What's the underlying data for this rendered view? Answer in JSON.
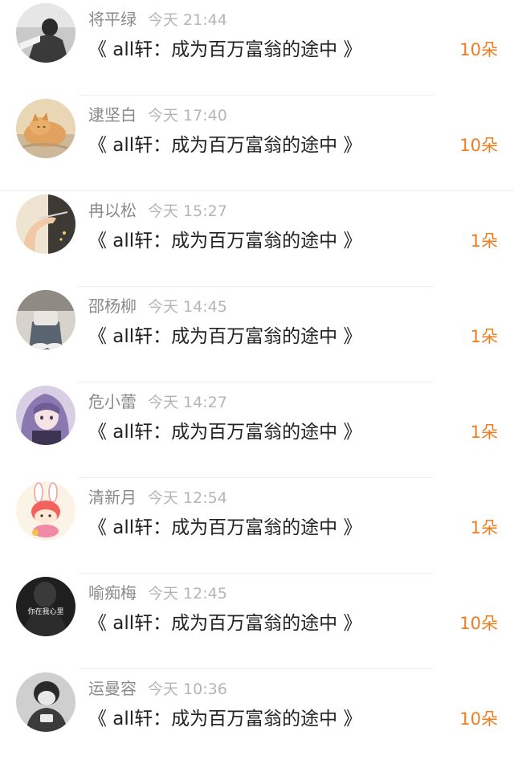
{
  "list": {
    "items": [
      {
        "name": "将平绿",
        "time": "今天 21:44",
        "book": "《 all轩：成为百万富翁的途中 》",
        "gift": "10朵",
        "avatar": "avatar-bw-person"
      },
      {
        "name": "逮坚白",
        "time": "今天 17:40",
        "book": "《 all轩：成为百万富翁的途中 》",
        "gift": "10朵",
        "avatar": "avatar-cat"
      },
      {
        "name": "冉以松",
        "time": "今天 15:27",
        "book": "《 all轩：成为百万富翁的途中 》",
        "gift": "1朵",
        "avatar": "avatar-hand"
      },
      {
        "name": "邵杨柳",
        "time": "今天 14:45",
        "book": "《 all轩：成为百万富翁的途中 》",
        "gift": "1朵",
        "avatar": "avatar-sitting"
      },
      {
        "name": "危小蕾",
        "time": "今天 14:27",
        "book": "《 all轩：成为百万富翁的途中 》",
        "gift": "1朵",
        "avatar": "avatar-anime-girl"
      },
      {
        "name": "清新月",
        "time": "今天 12:54",
        "book": "《 all轩：成为百万富翁的途中 》",
        "gift": "1朵",
        "avatar": "avatar-bunny-cartoon"
      },
      {
        "name": "喻痴梅",
        "time": "今天 12:45",
        "book": "《 all轩：成为百万富翁的途中 》",
        "gift": "10朵",
        "avatar": "avatar-dark-text",
        "avatar_text": "你在我心里"
      },
      {
        "name": "运曼容",
        "time": "今天 10:36",
        "book": "《 all轩：成为百万富翁的途中 》",
        "gift": "10朵",
        "avatar": "avatar-bw-child"
      }
    ]
  },
  "colors": {
    "accent": "#ef7d1f",
    "name": "#8a8a8a",
    "time": "#b5b5b5",
    "title": "#222222",
    "divider": "#eeeeee"
  }
}
